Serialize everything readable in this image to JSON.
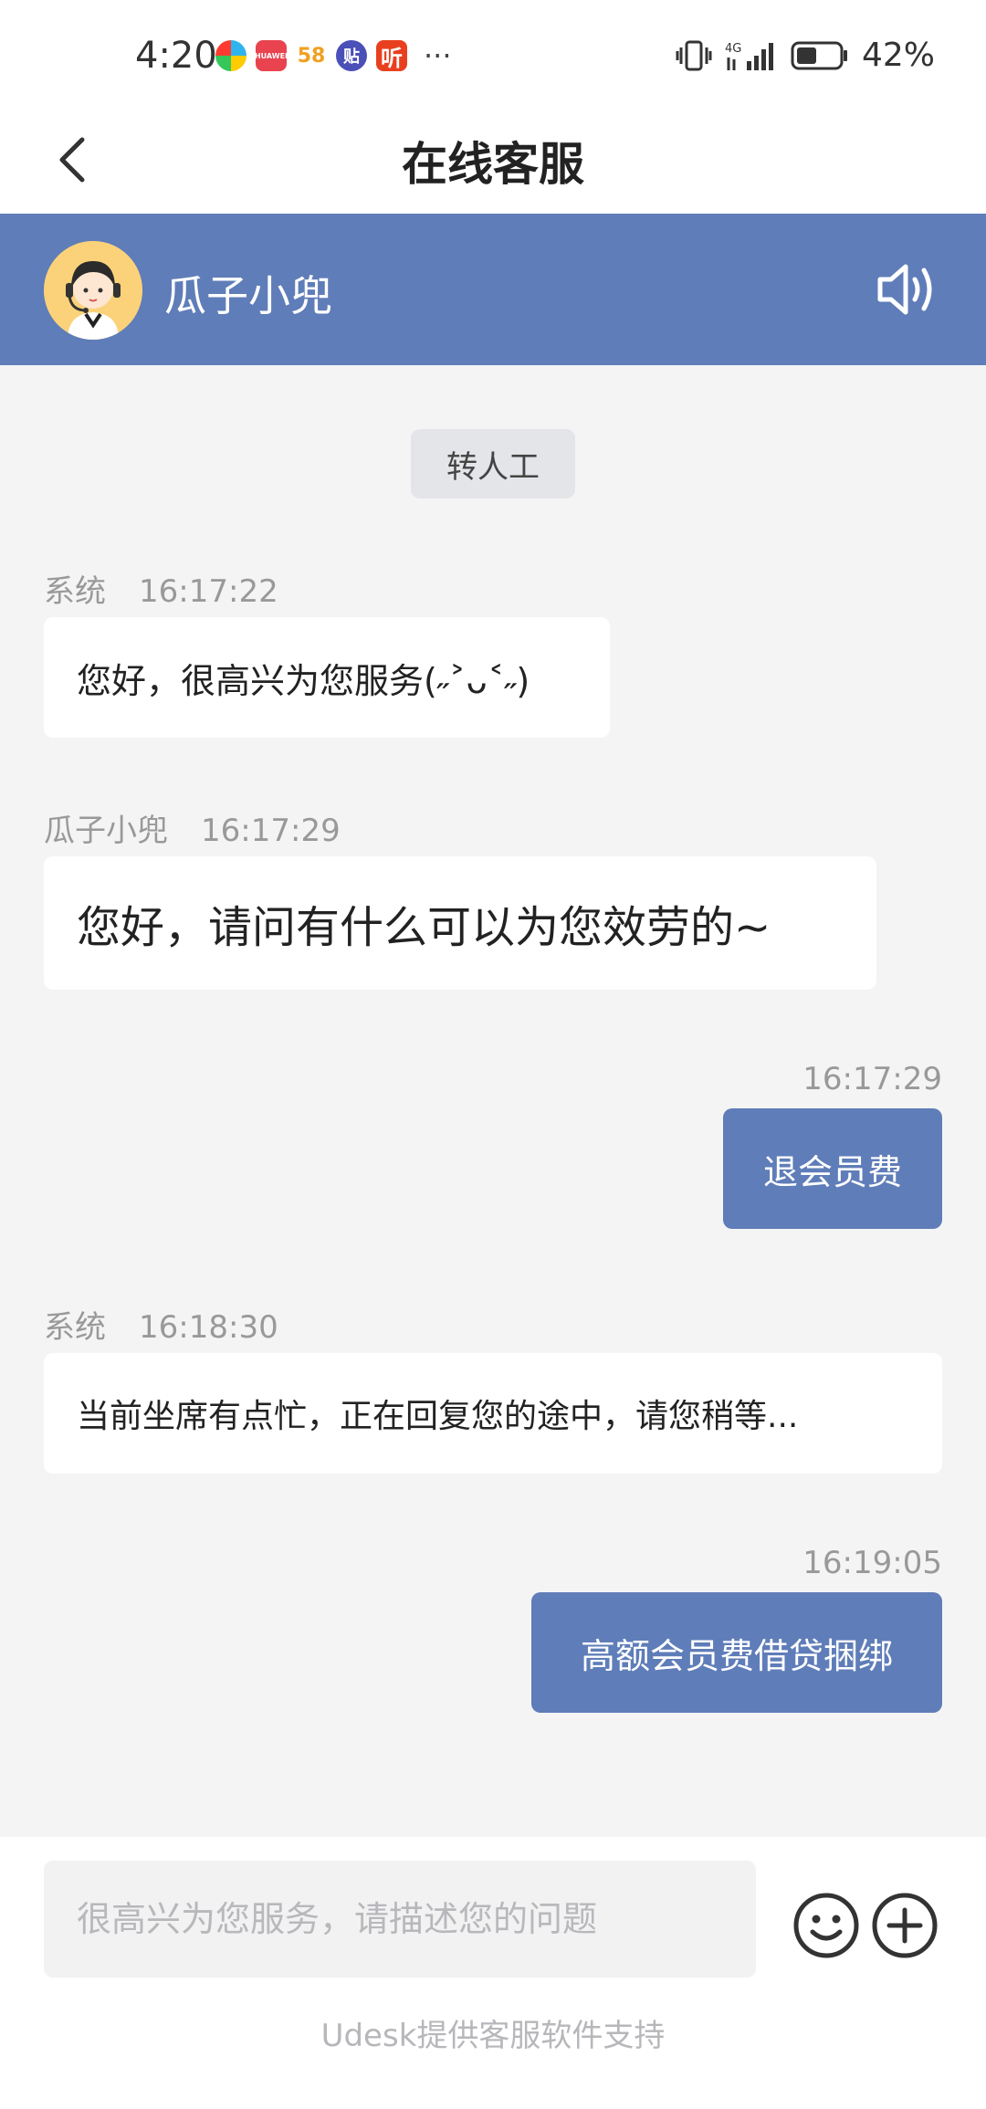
{
  "status_bar": {
    "time": "4:20",
    "apps": [
      {
        "name": "browser-app-icon",
        "text": "",
        "color": "#3aa0e8"
      },
      {
        "name": "huawei-appgallery-icon",
        "text": "HUAWEI",
        "color": "#e8434f"
      },
      {
        "name": "58-app-icon",
        "text": "58",
        "color": "#ffffff"
      },
      {
        "name": "tieba-app-icon",
        "text": "贴",
        "color": "#4b4fb8"
      },
      {
        "name": "listen-app-icon",
        "text": "听",
        "color": "#e8401f"
      }
    ],
    "more": "···",
    "network": "4G",
    "battery": "42%"
  },
  "header": {
    "title": "在线客服"
  },
  "agent": {
    "name": "瓜子小兜"
  },
  "chat": {
    "transfer_label": "转人工",
    "messages": [
      {
        "side": "left",
        "sender": "系统",
        "time": "16:17:22",
        "text": "您好，很高兴为您服务(˶˃ᴗ˂˶)"
      },
      {
        "side": "left",
        "sender": "瓜子小兜",
        "time": "16:17:29",
        "text": "您好，请问有什么可以为您效劳的~"
      },
      {
        "side": "right",
        "sender": "",
        "time": "16:17:29",
        "text": "退会员费"
      },
      {
        "side": "left",
        "sender": "系统",
        "time": "16:18:30",
        "text": "当前坐席有点忙，正在回复您的途中，请您稍等..."
      },
      {
        "side": "right",
        "sender": "",
        "time": "16:19:05",
        "text": "高额会员费借贷捆绑"
      }
    ]
  },
  "composer": {
    "placeholder": "很高兴为您服务，请描述您的问题",
    "value": "",
    "powered_by": "Udesk提供客服软件支持"
  },
  "colors": {
    "accent": "#5f7db8",
    "background": "#f4f4f5"
  }
}
